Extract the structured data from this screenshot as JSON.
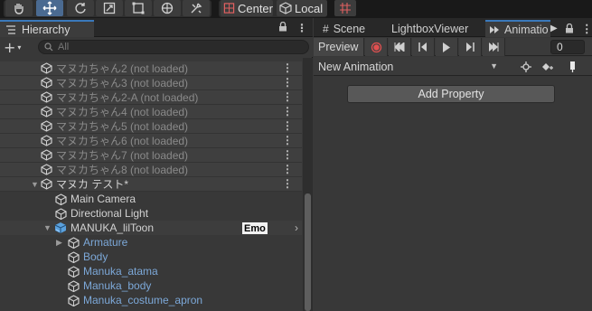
{
  "toolbar": {
    "pivot_label": "Center",
    "space_label": "Local",
    "tools": [
      "hand-tool",
      "move-tool",
      "rotate-tool",
      "scale-tool",
      "rect-tool",
      "transform-tool",
      "custom-tool"
    ]
  },
  "hierarchy": {
    "tab_label": "Hierarchy",
    "search_placeholder": "All",
    "rows": [
      {
        "label": "マヌカちゃん2 (not loaded)",
        "type": "scene",
        "unloaded": true
      },
      {
        "label": "マヌカちゃん3 (not loaded)",
        "type": "scene",
        "unloaded": true
      },
      {
        "label": "マヌカちゃん2-A (not loaded)",
        "type": "scene",
        "unloaded": true
      },
      {
        "label": "マヌカちゃん4 (not loaded)",
        "type": "scene",
        "unloaded": true
      },
      {
        "label": "マヌカちゃん5 (not loaded)",
        "type": "scene",
        "unloaded": true
      },
      {
        "label": "マヌカちゃん6 (not loaded)",
        "type": "scene",
        "unloaded": true
      },
      {
        "label": "マヌカちゃん7 (not loaded)",
        "type": "scene",
        "unloaded": true
      },
      {
        "label": "マヌカちゃん8 (not loaded)",
        "type": "scene",
        "unloaded": true
      },
      {
        "label": "マヌカ テスト*",
        "type": "scene",
        "unloaded": false
      },
      {
        "label": "Main Camera",
        "type": "object"
      },
      {
        "label": "Directional Light",
        "type": "object"
      },
      {
        "label": "MANUKA_lilToon",
        "type": "prefab-root",
        "badge": "Emo"
      },
      {
        "label": "Armature",
        "type": "child"
      },
      {
        "label": "Body",
        "type": "child"
      },
      {
        "label": "Manuka_atama",
        "type": "child"
      },
      {
        "label": "Manuka_body",
        "type": "child"
      },
      {
        "label": "Manuka_costume_apron",
        "type": "child"
      }
    ]
  },
  "right_tabs": {
    "scene": "Scene",
    "lightbox": "LightboxViewer",
    "animation": "Animatio"
  },
  "animation": {
    "preview_label": "Preview",
    "frame_value": "0",
    "clip_name": "New Animation",
    "add_property_label": "Add Property"
  }
}
